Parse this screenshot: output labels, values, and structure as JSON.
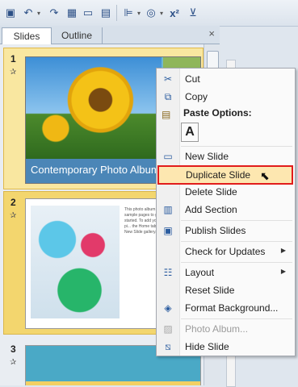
{
  "toolbar": {
    "superscript_label": "x²"
  },
  "panel": {
    "tabs": [
      {
        "label": "Slides"
      },
      {
        "label": "Outline"
      }
    ],
    "close_glyph": "×"
  },
  "slides": [
    {
      "number": "1",
      "title": "Contemporary Photo Album"
    },
    {
      "number": "2",
      "body": "This photo album ... sample pages to g... started. To add your own pi... the Home tab, the... New Slide gallery."
    },
    {
      "number": "3"
    }
  ],
  "menu": {
    "paste_header": "Paste Options:",
    "paste_option": "A",
    "items": [
      {
        "label": "Cut",
        "icon": "scissors-icon",
        "enabled": true
      },
      {
        "label": "Copy",
        "icon": "copy-icon",
        "enabled": true
      },
      {
        "label": "New Slide",
        "icon": "new-slide-icon",
        "enabled": true
      },
      {
        "label": "Duplicate Slide",
        "icon": "duplicate-slide-icon",
        "enabled": true,
        "highlighted": true
      },
      {
        "label": "Delete Slide",
        "icon": "delete-slide-icon",
        "enabled": true
      },
      {
        "label": "Add Section",
        "icon": "add-section-icon",
        "enabled": true
      },
      {
        "label": "Publish Slides",
        "icon": "publish-slides-icon",
        "enabled": true
      },
      {
        "label": "Check for Updates",
        "icon": "check-updates-icon",
        "enabled": true,
        "submenu": true
      },
      {
        "label": "Layout",
        "icon": "layout-icon",
        "enabled": true,
        "submenu": true
      },
      {
        "label": "Reset Slide",
        "icon": "reset-slide-icon",
        "enabled": true
      },
      {
        "label": "Format Background...",
        "icon": "format-background-icon",
        "enabled": true
      },
      {
        "label": "Photo Album...",
        "icon": "photo-album-icon",
        "enabled": false
      },
      {
        "label": "Hide Slide",
        "icon": "hide-slide-icon",
        "enabled": true
      }
    ]
  },
  "colors": {
    "highlight_border": "#e11c1c",
    "highlight_fill": "#fde7b0",
    "selected_slide": "#f9e7a0"
  }
}
